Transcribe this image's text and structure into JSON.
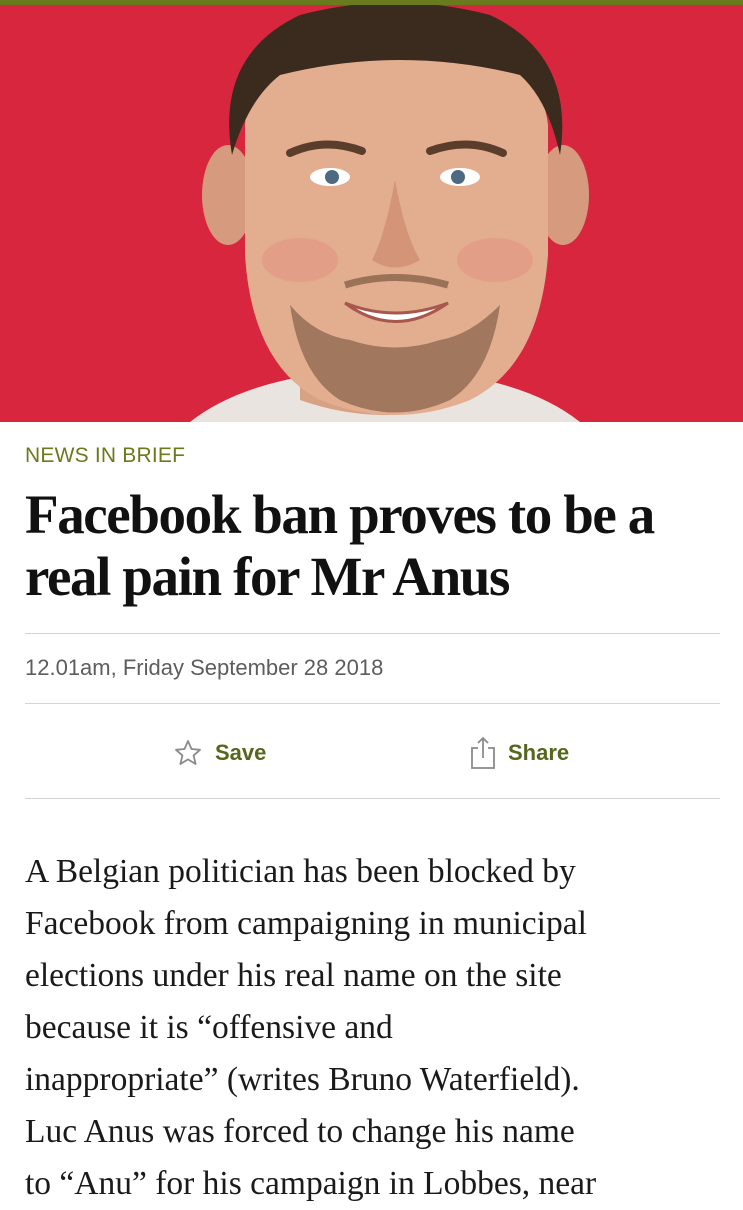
{
  "article": {
    "section": "NEWS IN BRIEF",
    "headline_lines": [
      "Facebook ban proves to be a",
      "real pain for Mr Anus"
    ],
    "dateline": "12.01am, Friday September 28 2018",
    "hero_image": "portrait of smiling man on red background",
    "body_lines": [
      "A Belgian politician has been blocked by",
      "Facebook from campaigning in municipal",
      "elections under his real name on the site",
      "because it is “offensive and",
      "inappropriate” (writes Bruno Waterfield).",
      "Luc Anus was forced to change his name",
      "to “Anu” for his campaign in Lobbes, near"
    ]
  },
  "actions": {
    "save_label": "Save",
    "save_icon": "star-outline-icon",
    "share_label": "Share",
    "share_icon": "share-icon"
  },
  "colors": {
    "accent": "#6b7a1c",
    "hero_background": "#d7263d",
    "top_bar": "#6a7a1e"
  }
}
